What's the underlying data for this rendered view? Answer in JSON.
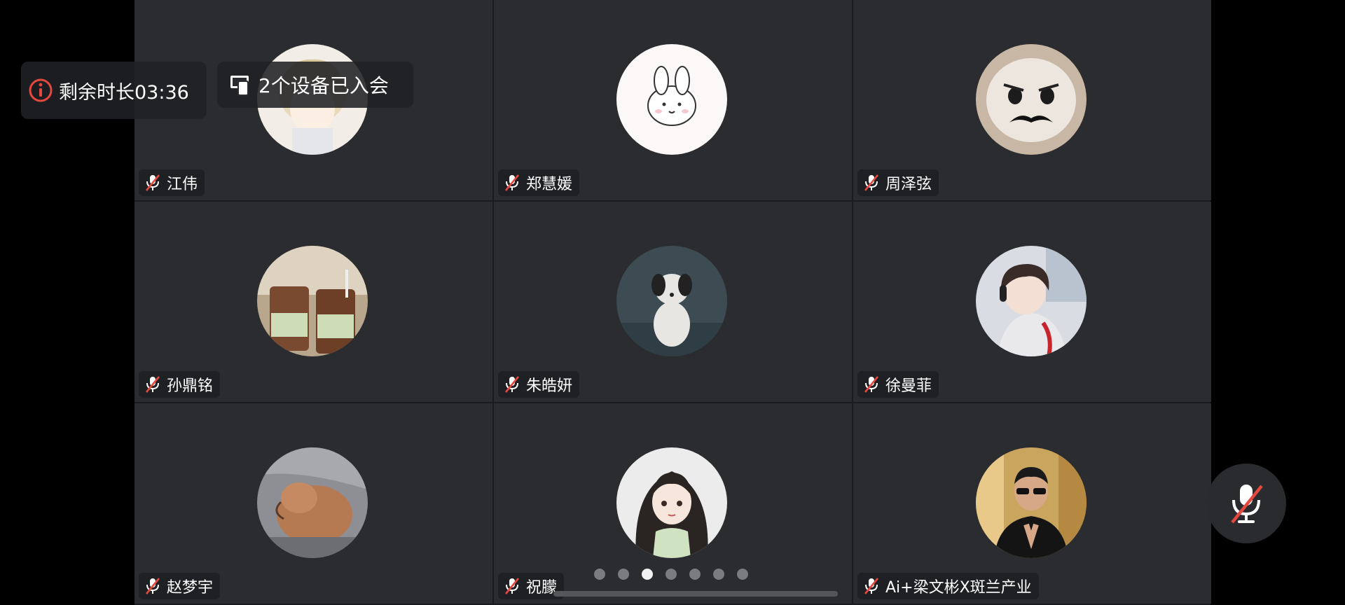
{
  "meeting": {
    "remaining_time": "剩余时长03:36",
    "devices_joined": "2个设备已入会"
  },
  "participants": [
    {
      "name": "江伟",
      "mic": "muted",
      "avatar": "anime-boy-avatar"
    },
    {
      "name": "郑慧媛",
      "mic": "muted",
      "avatar": "cartoon-bunny-avatar"
    },
    {
      "name": "周泽弦",
      "mic": "muted",
      "avatar": "mustache-cat-avatar"
    },
    {
      "name": "孙鼎铭",
      "mic": "muted",
      "avatar": "coffee-cups-avatar"
    },
    {
      "name": "朱皓妍",
      "mic": "muted",
      "avatar": "puppy-photo-avatar"
    },
    {
      "name": "徐曼菲",
      "mic": "muted",
      "avatar": "anime-gamer-avatar"
    },
    {
      "name": "赵梦宇",
      "mic": "muted",
      "avatar": "sleeping-dog-avatar"
    },
    {
      "name": "祝朦",
      "mic": "muted",
      "avatar": "anime-girl-avatar"
    },
    {
      "name": "Ai+梁文彬X斑兰产业",
      "mic": "muted",
      "avatar": "man-sunglasses-avatar"
    }
  ],
  "pagination": {
    "total_pages": 7,
    "current_page": 3
  },
  "controls": {
    "self_mic": "muted",
    "self_mic_icon": "mic-off-icon"
  },
  "colors": {
    "tile_bg": "#2b2c2f",
    "muted_red": "#e5483f",
    "info_red": "#e5483f"
  }
}
